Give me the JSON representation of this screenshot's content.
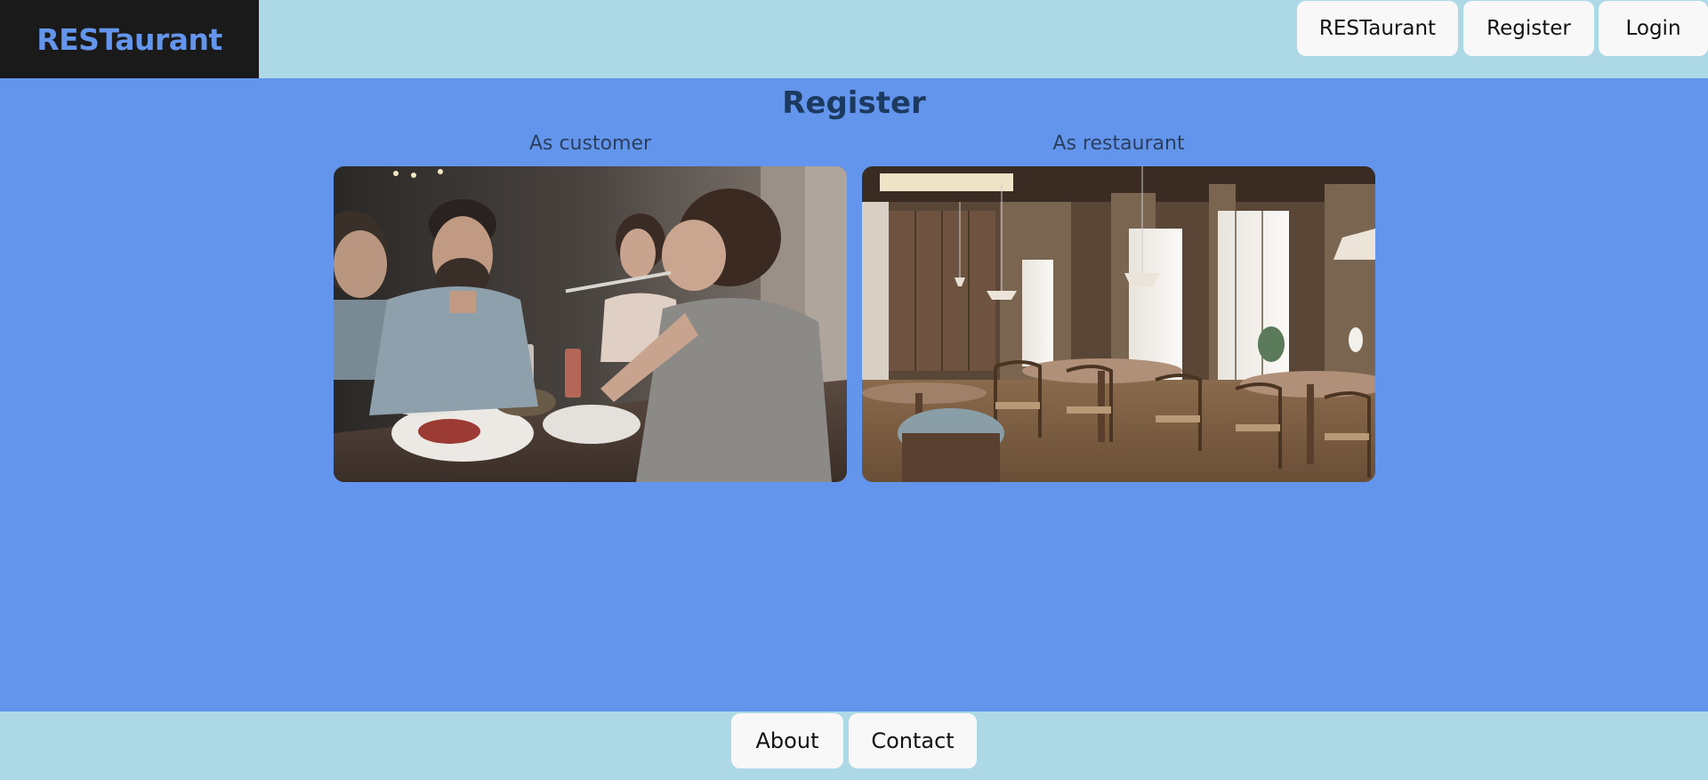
{
  "brand": {
    "name": "RESTaurant"
  },
  "nav": {
    "items": [
      {
        "label": "RESTaurant"
      },
      {
        "label": "Register"
      },
      {
        "label": "Login"
      }
    ]
  },
  "main": {
    "title": "Register",
    "options": [
      {
        "label": "As customer",
        "image": "people-dining-photo"
      },
      {
        "label": "As restaurant",
        "image": "restaurant-interior-photo"
      }
    ]
  },
  "footer": {
    "items": [
      {
        "label": "About"
      },
      {
        "label": "Contact"
      }
    ]
  },
  "colors": {
    "page_background": "#6495ed",
    "header_background": "#add8e6",
    "brand_block": "#1a1a1a",
    "brand_text": "#6495ed",
    "button_background": "#f8f8f8",
    "title_text": "#1c3a5f"
  }
}
